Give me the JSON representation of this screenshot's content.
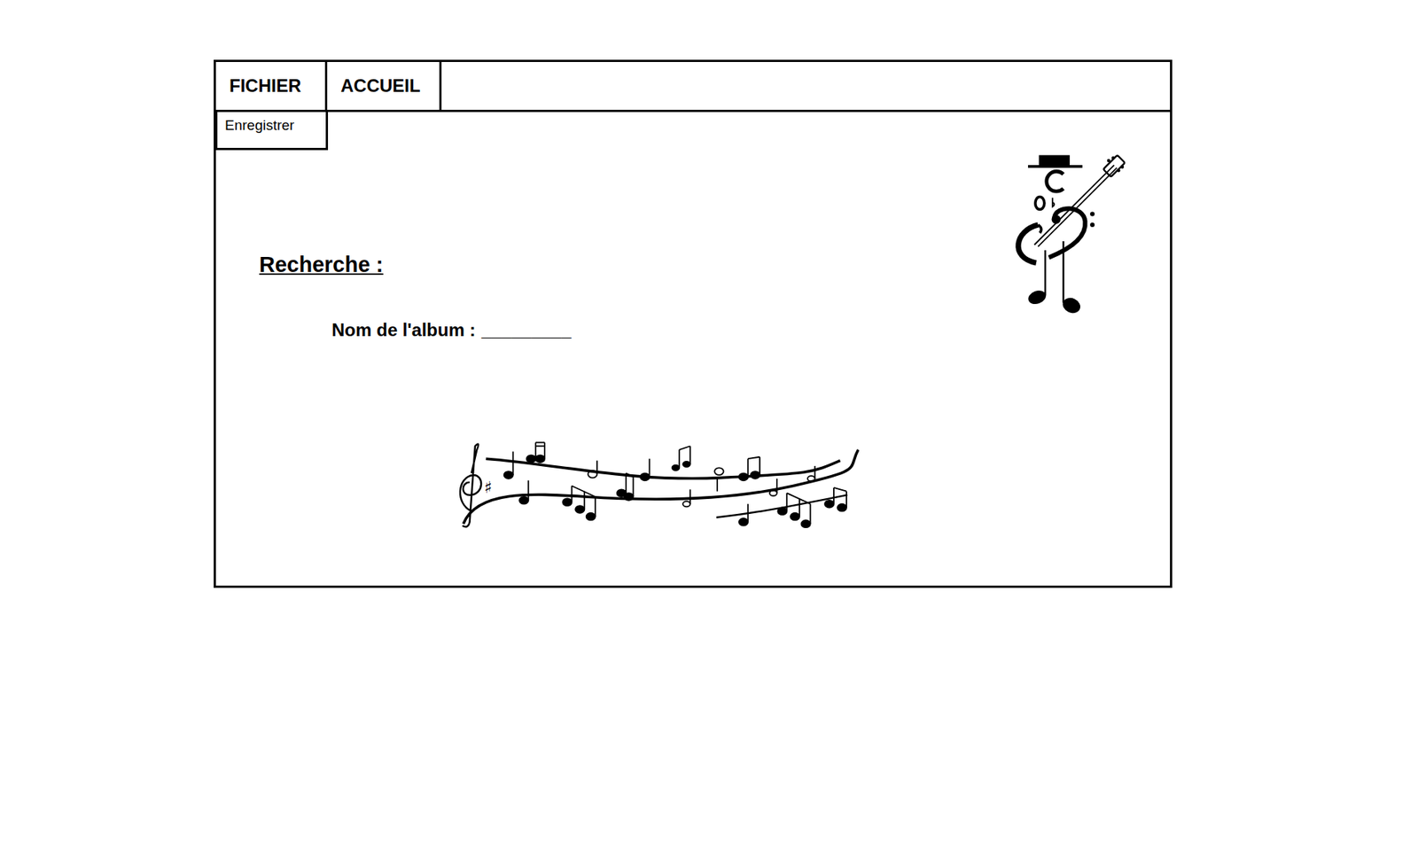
{
  "tabs": [
    {
      "label": "FICHIER",
      "selected": false,
      "expanded": true,
      "menu": [
        {
          "label": "Enregistrer"
        }
      ]
    },
    {
      "label": "ACCUEIL",
      "selected": false,
      "expanded": false,
      "menu": []
    }
  ],
  "search": {
    "heading": "Recherche :",
    "fields": [
      {
        "label": "Nom de l'album :",
        "value": "_________"
      }
    ]
  }
}
